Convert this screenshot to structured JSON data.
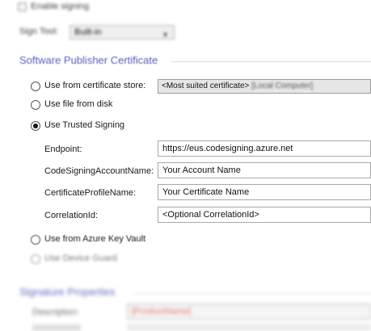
{
  "top": {
    "enable_signing_label": "Enable signing",
    "sign_tool_label": "Sign Tool:",
    "sign_tool_value": "Built-in"
  },
  "publisher": {
    "section_title": "Software Publisher Certificate",
    "options": {
      "certificate_store": "Use from certificate store:",
      "file_from_disk": "Use file from disk",
      "trusted_signing": "Use Trusted Signing",
      "azure_key_vault": "Use from Azure Key Vault",
      "device_guard": "Use Device Guard"
    },
    "certificate_combo": {
      "selected": "<Most suited certificate>",
      "location": "[Local Computer]"
    },
    "selected_option": "trusted_signing",
    "fields": {
      "endpoint_label": "Endpoint:",
      "endpoint_value": "https://eus.codesigning.azure.net",
      "account_label": "CodeSigningAccountName:",
      "account_value": "Your Account Name",
      "profile_label": "CertificateProfileName:",
      "profile_value": "Your Certificate Name",
      "correlation_label": "CorrelationId:",
      "correlation_value": "<Optional CorrelationId>"
    }
  },
  "signature": {
    "section_title": "Signature Properties",
    "description_label": "Description:",
    "description_value": "[ProductName]"
  },
  "colors": {
    "section_title": "#5562b8",
    "placeholder_red": "#d9534f"
  }
}
